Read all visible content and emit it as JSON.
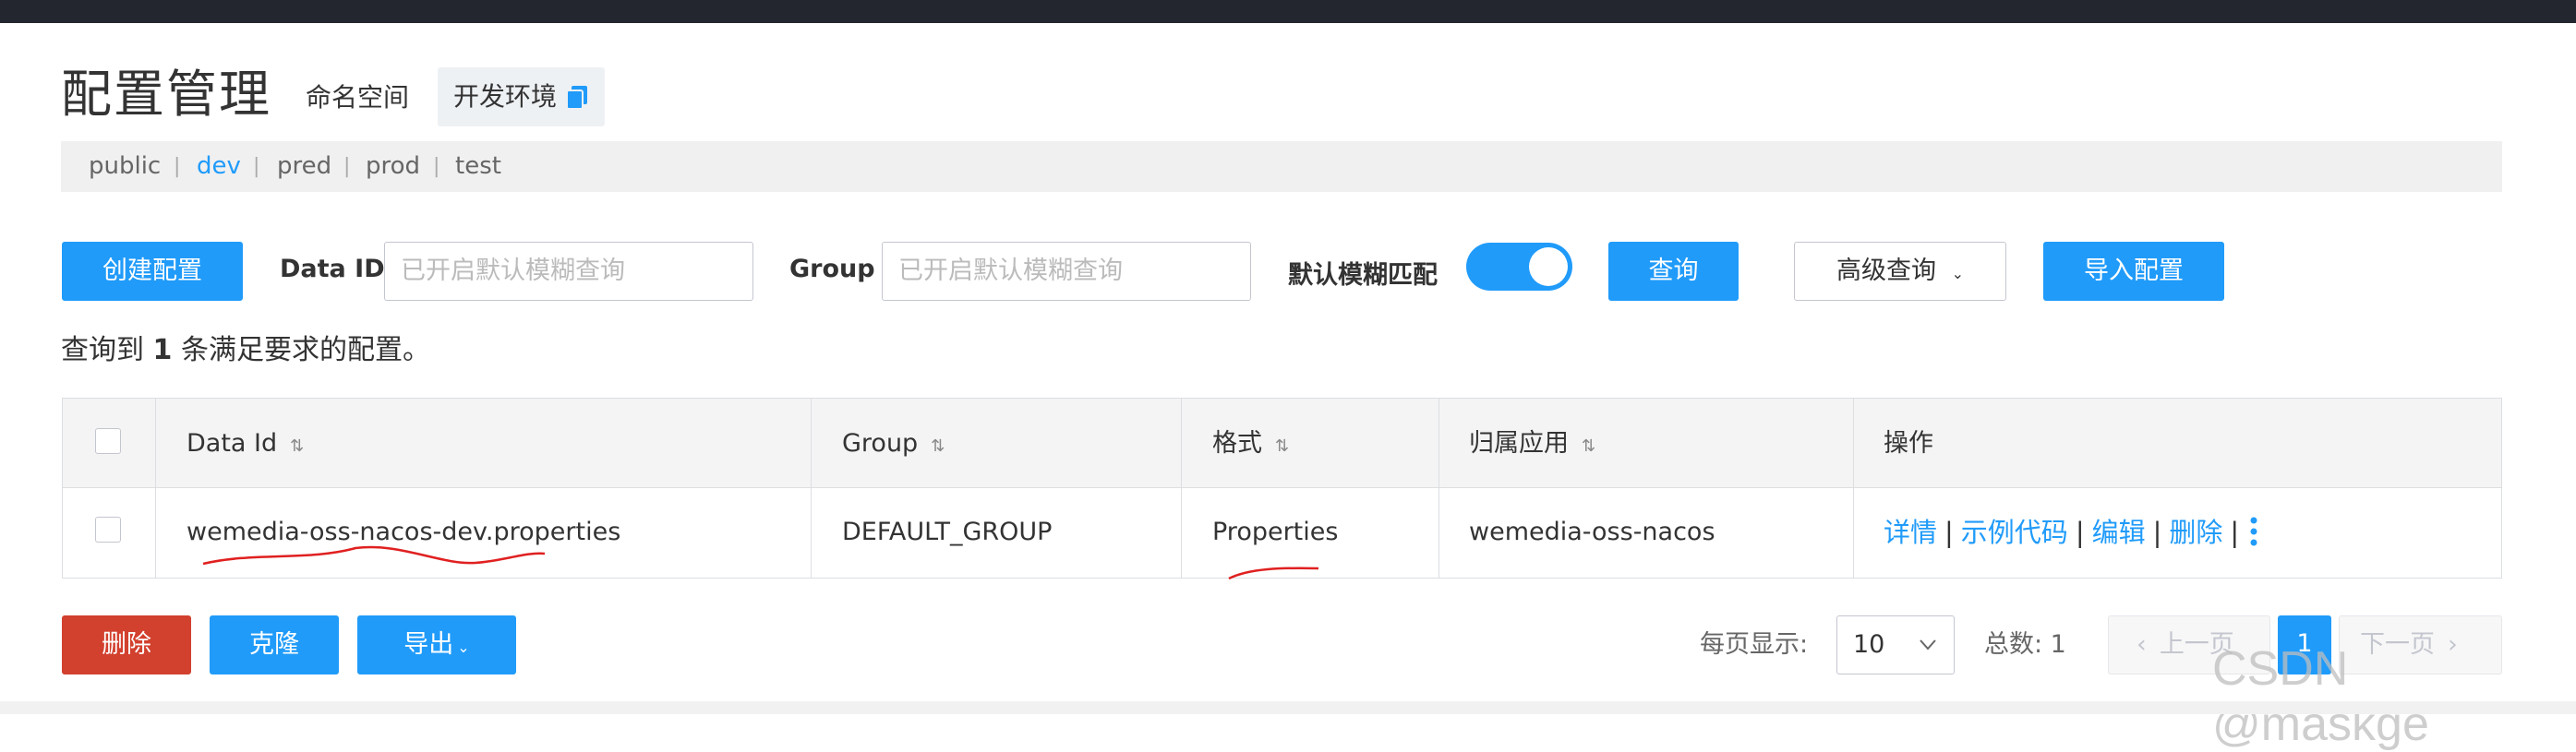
{
  "header": {
    "title": "配置管理",
    "namespace_label": "命名空间",
    "env_name": "开发环境"
  },
  "namespaces": [
    "public",
    "dev",
    "pred",
    "prod",
    "test"
  ],
  "active_namespace": "dev",
  "toolbar": {
    "create_label": "创建配置",
    "data_id_label": "Data ID",
    "data_id_placeholder": "已开启默认模糊查询",
    "group_label": "Group",
    "group_placeholder": "已开启默认模糊查询",
    "fuzzy_label": "默认模糊匹配",
    "fuzzy_enabled": true,
    "query_label": "查询",
    "advanced_label": "高级查询",
    "import_label": "导入配置"
  },
  "result": {
    "prefix": "查询到",
    "count": "1",
    "suffix": "条满足要求的配置。"
  },
  "table": {
    "headers": [
      "Data Id",
      "Group",
      "格式",
      "归属应用",
      "操作"
    ],
    "rows": [
      {
        "data_id": "wemedia-oss-nacos-dev.properties",
        "group": "DEFAULT_GROUP",
        "format": "Properties",
        "app": "wemedia-oss-nacos",
        "ops": [
          "详情",
          "示例代码",
          "编辑",
          "删除"
        ]
      }
    ]
  },
  "bottom": {
    "delete_label": "删除",
    "clone_label": "克隆",
    "export_label": "导出"
  },
  "pagination": {
    "per_page_label": "每页显示:",
    "per_page_value": "10",
    "total_label": "总数: 1",
    "prev_label": "上一页",
    "current_page": "1",
    "next_label": "下一页"
  },
  "watermark": "CSDN @maskge",
  "colors": {
    "primary": "#209bfa",
    "danger": "#d2402e",
    "annotation": "#e02020"
  }
}
